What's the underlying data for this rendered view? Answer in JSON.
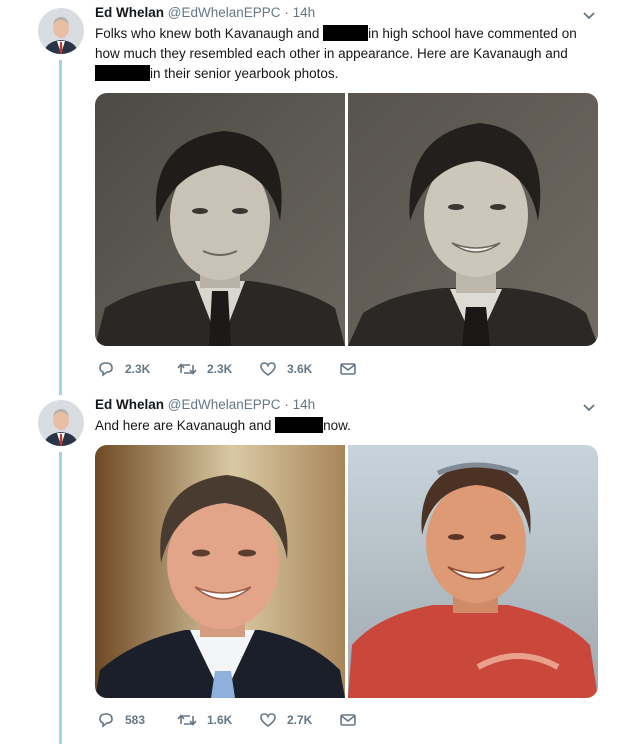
{
  "tweets": [
    {
      "author_name": "Ed Whelan",
      "handle": "@EdWhelanEPPC",
      "separator": "·",
      "time": "14h",
      "text_parts": [
        "Folks who knew both Kavanaugh and ",
        "in high school have commented on how much they resembled each other in appearance. Here are Kavanaugh and ",
        "in their senior yearbook photos."
      ],
      "actions": {
        "replies": "2.3K",
        "retweets": "2.3K",
        "likes": "3.6K"
      }
    },
    {
      "author_name": "Ed Whelan",
      "handle": "@EdWhelanEPPC",
      "separator": "·",
      "time": "14h",
      "text_parts": [
        "And here are Kavanaugh and ",
        "now."
      ],
      "actions": {
        "replies": "583",
        "retweets": "1.6K",
        "likes": "2.7K"
      }
    }
  ],
  "icons": [
    "reply-icon",
    "retweet-icon",
    "like-icon",
    "message-icon",
    "chevron-down-icon"
  ],
  "colors": {
    "thread_line": "#9fd3f5",
    "icon_gray": "#657786",
    "name": "#14171a"
  }
}
